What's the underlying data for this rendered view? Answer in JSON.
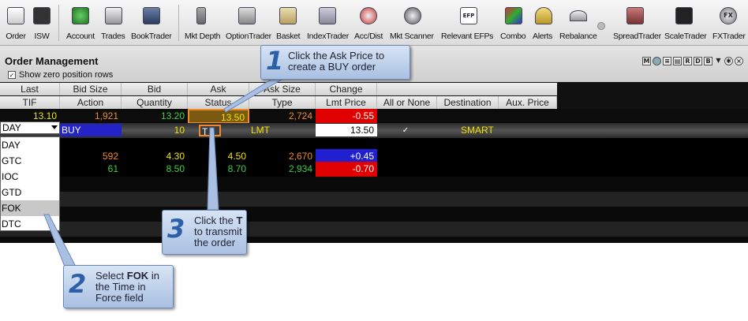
{
  "toolbar": {
    "items": [
      {
        "label": "Order",
        "icon": "order-icon"
      },
      {
        "label": "ISW",
        "icon": "isw-icon"
      },
      {
        "label": "Account",
        "icon": "account-icon"
      },
      {
        "label": "Trades",
        "icon": "trades-icon"
      },
      {
        "label": "BookTrader",
        "icon": "booktrader-icon"
      },
      {
        "label": "Mkt Depth",
        "icon": "mkt-depth-icon"
      },
      {
        "label": "OptionTrader",
        "icon": "optiontrader-icon"
      },
      {
        "label": "Basket",
        "icon": "basket-icon"
      },
      {
        "label": "IndexTrader",
        "icon": "indextrader-icon"
      },
      {
        "label": "Acc/Dist",
        "icon": "acc-dist-icon"
      },
      {
        "label": "Mkt Scanner",
        "icon": "mkt-scanner-icon"
      },
      {
        "label": "Relevant EFPs",
        "icon": "efp-icon"
      },
      {
        "label": "Combo",
        "icon": "combo-icon"
      },
      {
        "label": "Alerts",
        "icon": "alerts-icon"
      },
      {
        "label": "Rebalance",
        "icon": "rebalance-icon"
      },
      {
        "label": "SpreadTrader",
        "icon": "spreadtrader-icon"
      },
      {
        "label": "ScaleTrader",
        "icon": "scaletrader-icon"
      },
      {
        "label": "FXTrader",
        "icon": "fxtrader-icon"
      }
    ]
  },
  "panel": {
    "title": "Order Management",
    "show_zero_label": "Show zero position rows",
    "show_zero_checked": "✓"
  },
  "headers": {
    "row1": [
      "Last",
      "Bid Size",
      "Bid",
      "Ask",
      "Ask Size",
      "Change"
    ],
    "row2": [
      "TIF",
      "Action",
      "Quantity",
      "Status",
      "Type",
      "Lmt Price",
      "All or None",
      "Destination",
      "Aux. Price"
    ]
  },
  "market_row": {
    "last": "13.10",
    "bid_size": "1,921",
    "bid": "13.20",
    "ask": "13.50",
    "ask_size": "2,724",
    "change": "-0.55"
  },
  "order_row": {
    "tif": "DAY",
    "action": "BUY",
    "quantity": "10",
    "status": "T",
    "type": "LMT",
    "lmt_price": "13.50",
    "all_or_none": "✓",
    "destination": "SMART"
  },
  "rows": [
    {
      "bid_size": "592",
      "bid": "4.30",
      "ask": "4.50",
      "ask_size": "2,670",
      "change": "+0.45"
    },
    {
      "bid_size": "61",
      "bid": "8.50",
      "ask": "8.70",
      "ask_size": "2,934",
      "change": "-0.70"
    }
  ],
  "tif_options": [
    "DAY",
    "GTC",
    "IOC",
    "GTD",
    "FOK",
    "DTC"
  ],
  "callouts": [
    {
      "num": "1",
      "line1": "Click the Ask Price to",
      "line2": "create a BUY order"
    },
    {
      "num": "2",
      "line1a": "Select ",
      "line1b": "FOK",
      "line1c": " in",
      "line2": "the Time in",
      "line3": "Force field"
    },
    {
      "num": "3",
      "line1": "Click the ",
      "line1b": "T",
      "line2": "to transmit",
      "line3": "the order"
    }
  ],
  "colors": {
    "positive": "#2020d0",
    "negative": "#e00000",
    "accent_highlight": "#f08a2a"
  }
}
